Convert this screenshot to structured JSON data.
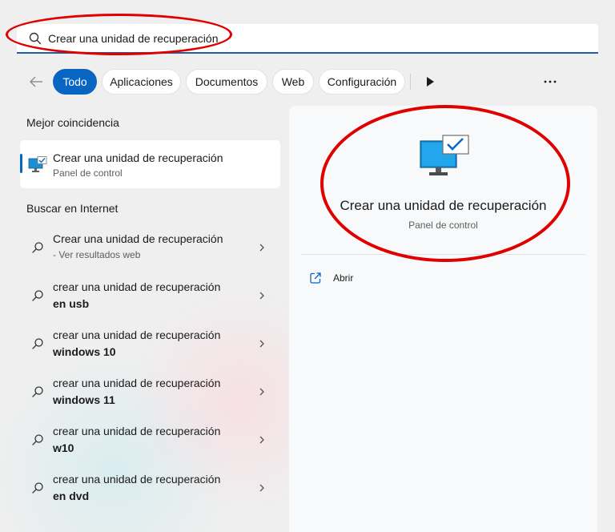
{
  "search": {
    "query": "Crear una unidad de recuperación",
    "icon": "search-icon"
  },
  "filters": {
    "back_icon": "arrow-left-icon",
    "chips": [
      "Todo",
      "Aplicaciones",
      "Documentos",
      "Web",
      "Configuración"
    ],
    "active": "Todo",
    "play_icon": "play-icon",
    "more_icon": "more-horizontal-icon"
  },
  "best_match": {
    "heading": "Mejor coincidencia",
    "title": "Crear una unidad de recuperación",
    "subtitle": "Panel de control",
    "icon": "monitor-check-icon"
  },
  "web": {
    "heading": "Buscar en Internet",
    "items": [
      {
        "line1": "Crear una unidad de recuperación",
        "line2": "- Ver resultados web"
      },
      {
        "line1": "crear una unidad de recuperación",
        "line2": "en usb"
      },
      {
        "line1": "crear una unidad de recuperación",
        "line2": "windows 10"
      },
      {
        "line1": "crear una unidad de recuperación",
        "line2": "windows 11"
      },
      {
        "line1": "crear una unidad de recuperación",
        "line2": "w10"
      },
      {
        "line1": "crear una unidad de recuperación",
        "line2": "en dvd"
      }
    ]
  },
  "detail": {
    "title": "Crear una unidad de recuperación",
    "subtitle": "Panel de control",
    "action_label": "Abrir",
    "action_icon": "open-external-icon"
  },
  "colors": {
    "accent": "#0865c1",
    "annotation_red": "#e00000"
  }
}
